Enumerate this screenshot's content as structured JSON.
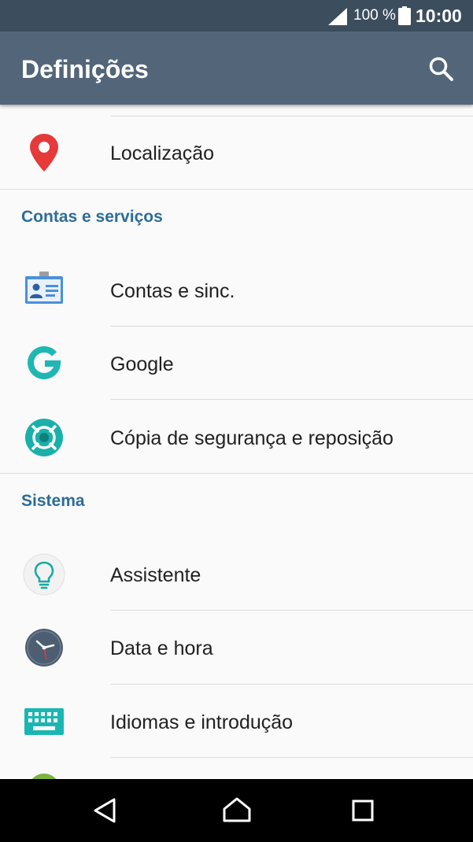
{
  "status_bar": {
    "battery_percent": "100 %",
    "time": "10:00",
    "icons": [
      "signal-icon",
      "battery-icon"
    ]
  },
  "app_bar": {
    "title": "Definições",
    "search_icon": "search-icon"
  },
  "items": {
    "location": {
      "label": "Localização",
      "icon": "location-pin-icon"
    },
    "accounts_header": "Contas e serviços",
    "accounts_sync": {
      "label": "Contas e sinc.",
      "icon": "accounts-card-icon"
    },
    "google": {
      "label": "Google",
      "icon": "google-icon"
    },
    "backup": {
      "label": "Cópia de segurança e reposição",
      "icon": "backup-reset-icon"
    },
    "system_header": "Sistema",
    "assistant": {
      "label": "Assistente",
      "icon": "lightbulb-icon"
    },
    "date_time": {
      "label": "Data e hora",
      "icon": "clock-icon"
    },
    "languages": {
      "label": "Idiomas e introdução",
      "icon": "keyboard-icon"
    }
  },
  "nav_bar": {
    "back": "back-icon",
    "home": "home-icon",
    "recents": "recents-icon"
  },
  "colors": {
    "status_bar": "#3c4d5e",
    "app_bar": "#536579",
    "section_header": "#2c6d99",
    "background": "#fafafa"
  }
}
